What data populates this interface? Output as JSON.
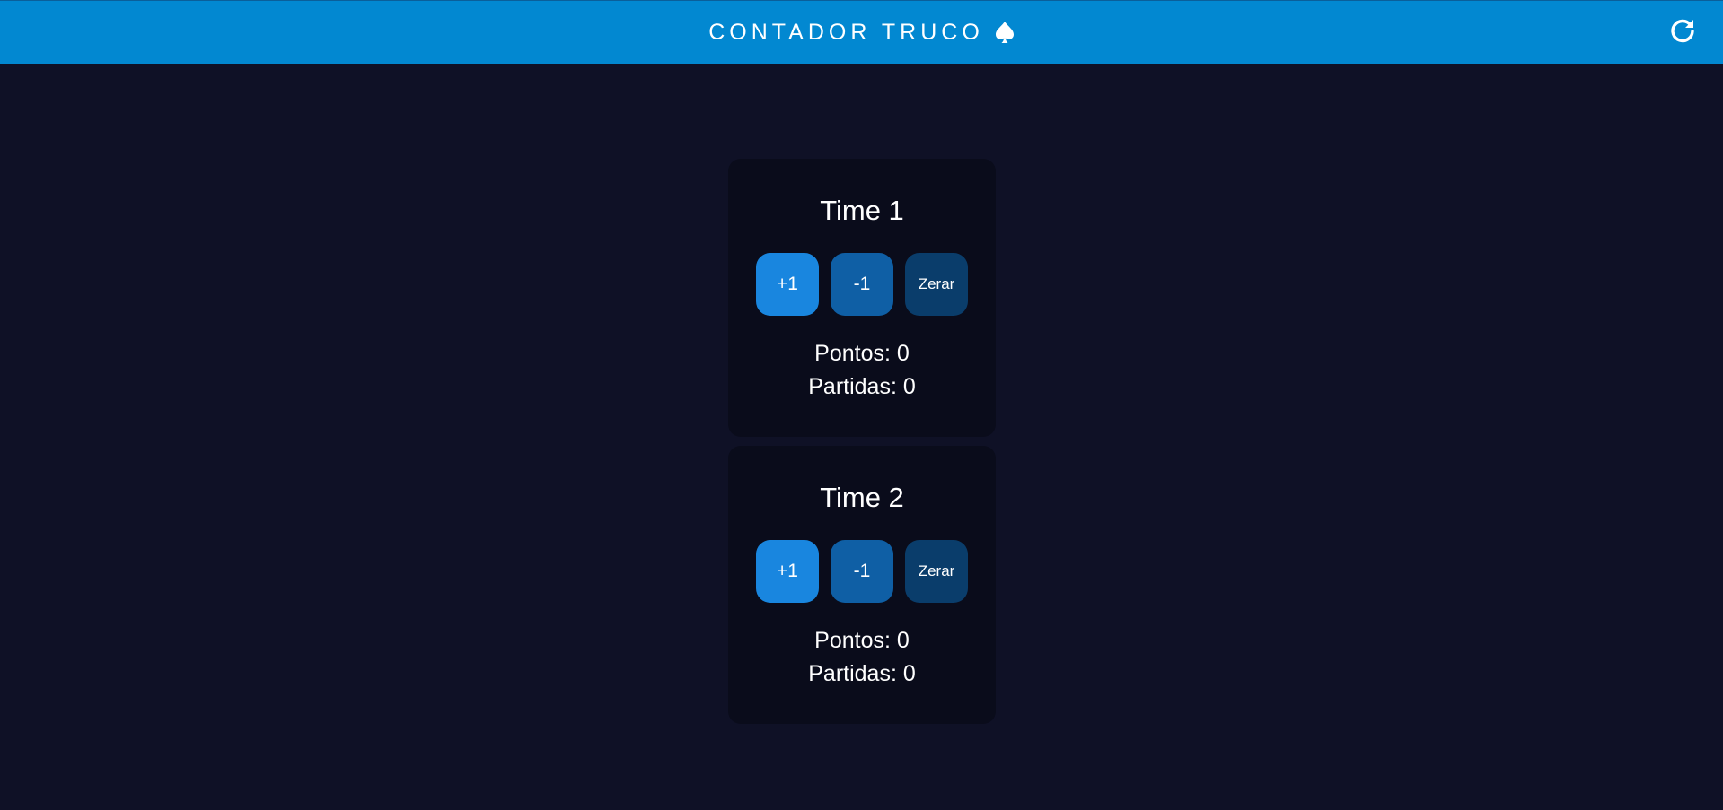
{
  "app": {
    "title": "CONTADOR TRUCO",
    "title_icon": "spade-icon",
    "refresh_icon": "refresh-icon",
    "colors": {
      "app_bar": "#0288d1",
      "background": "#0f1126",
      "card": "#0a0c1b",
      "btn_plus": "#1986df",
      "btn_minus": "#0f5fa5",
      "btn_reset": "#0a3d6b"
    }
  },
  "teams": [
    {
      "name": "Time 1",
      "plus_label": "+1",
      "minus_label": "-1",
      "reset_label": "Zerar",
      "points_text": "Pontos: 0",
      "matches_text": "Partidas: 0"
    },
    {
      "name": "Time 2",
      "plus_label": "+1",
      "minus_label": "-1",
      "reset_label": "Zerar",
      "points_text": "Pontos: 0",
      "matches_text": "Partidas: 0"
    }
  ]
}
